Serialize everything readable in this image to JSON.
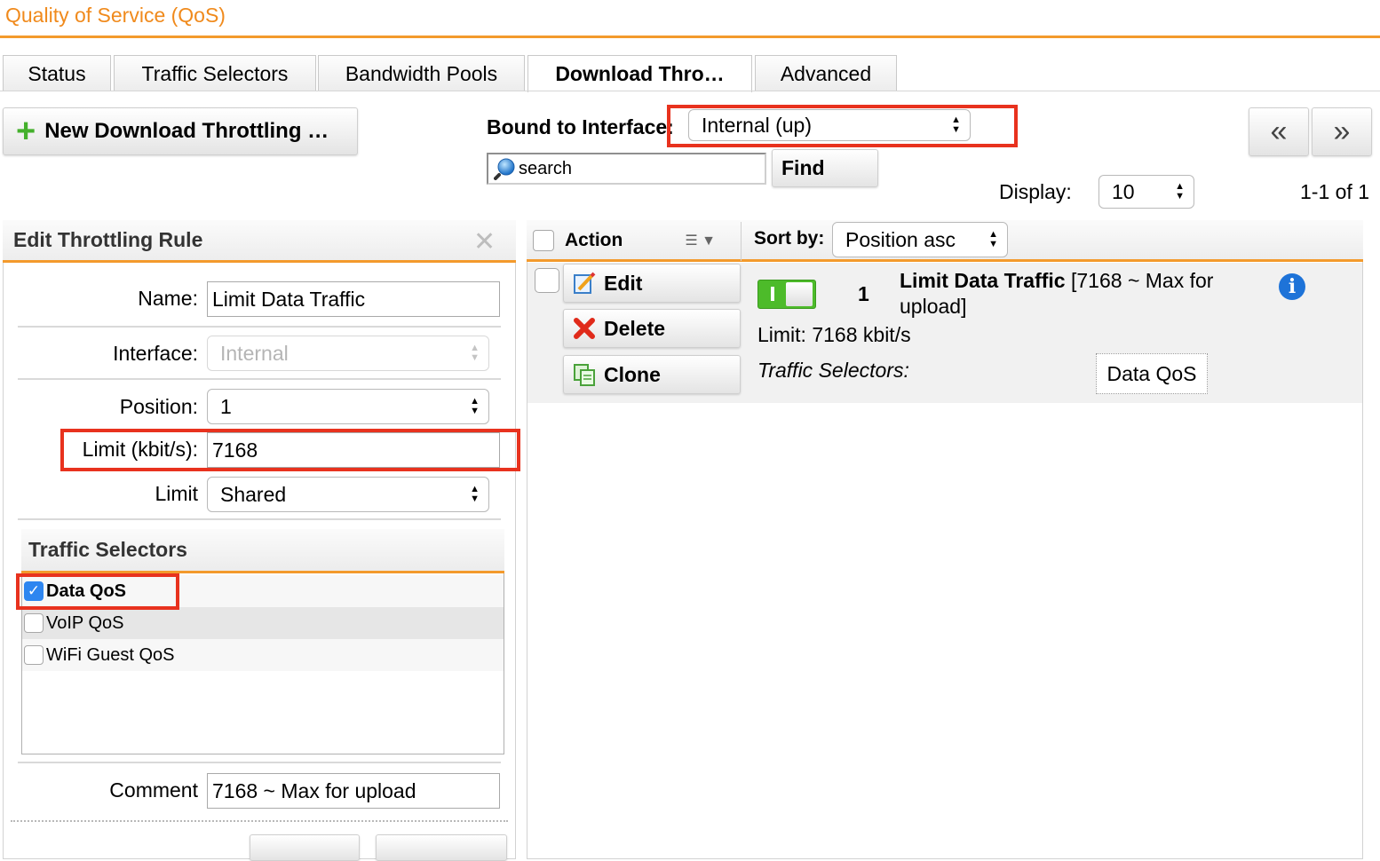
{
  "header": {
    "title": "Quality of Service (QoS)"
  },
  "tabs": [
    {
      "label": "Status"
    },
    {
      "label": "Traffic Selectors"
    },
    {
      "label": "Bandwidth Pools"
    },
    {
      "label": "Download Thro…",
      "active": true
    },
    {
      "label": "Advanced"
    }
  ],
  "toolbar": {
    "new_label": "New Download Throttling …",
    "bound_label": "Bound to Interface:",
    "bound_value": "Internal (up)",
    "search_placeholder": "search",
    "find_label": "Find",
    "prev_label": "«",
    "next_label": "»",
    "display_label": "Display:",
    "display_value": "10",
    "range_text": "1-1 of 1"
  },
  "edit_panel": {
    "title": "Edit Throttling Rule",
    "close_label": "✕",
    "name_label": "Name:",
    "name_value": "Limit Data Traffic",
    "interface_label": "Interface:",
    "interface_value": "Internal",
    "position_label": "Position:",
    "position_value": "1",
    "limit_label": "Limit (kbit/s):",
    "limit_value": "7168",
    "limit_mode_label": "Limit",
    "limit_mode_value": "Shared",
    "selectors_title": "Traffic Selectors",
    "selectors": [
      {
        "label": "Data QoS",
        "checked": true
      },
      {
        "label": "VoIP QoS",
        "checked": false
      },
      {
        "label": "WiFi Guest QoS",
        "checked": false
      }
    ],
    "comment_label": "Comment",
    "comment_value": "7168 ~ Max for upload"
  },
  "list_panel": {
    "action_label": "Action",
    "sort_label": "Sort by:",
    "sort_value": "Position asc",
    "rule": {
      "edit_label": "Edit",
      "delete_label": "Delete",
      "clone_label": "Clone",
      "position": "1",
      "name": "Limit Data Traffic",
      "detail": "[7168 ~ Max for upload]",
      "limit_text": "Limit: 7168 kbit/s",
      "selectors_label": "Traffic Selectors:",
      "selector_tag": "Data QoS",
      "info_label": "i",
      "enabled": true
    }
  },
  "colors": {
    "accent": "#f39a2c",
    "title": "#f08a1c",
    "highlight": "#e8321e",
    "toggle_on": "#4dbb2a",
    "checkbox": "#2e86f0",
    "info": "#1e73d8"
  }
}
